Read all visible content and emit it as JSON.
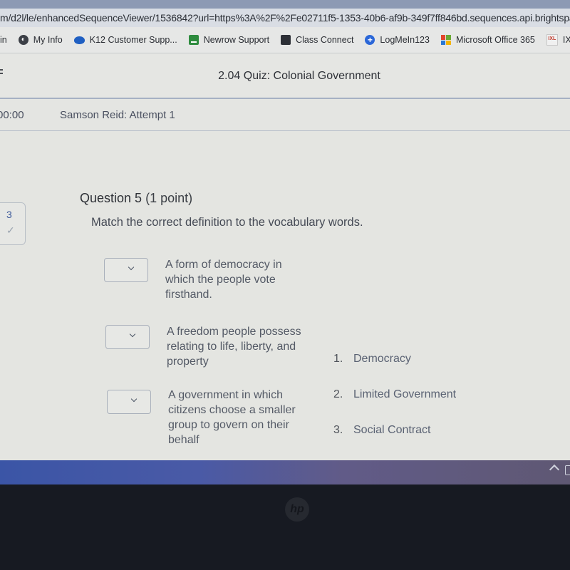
{
  "browser": {
    "url": "m/d2l/le/enhancedSequenceViewer/1536842?url=https%3A%2F%2Fe02711f5-1353-40b6-af9b-349f7ff846bd.sequences.api.brightspace.com",
    "bookmarks": [
      {
        "label": "in",
        "icon": "none"
      },
      {
        "label": "My Info",
        "icon": "globe-icon"
      },
      {
        "label": "K12 Customer Supp...",
        "icon": "cloud-icon"
      },
      {
        "label": "Newrow Support",
        "icon": "newrow-icon"
      },
      {
        "label": "Class Connect",
        "icon": "class-connect-icon"
      },
      {
        "label": "LogMeIn123",
        "icon": "logmein-icon"
      },
      {
        "label": "Microsoft Office 365",
        "icon": "microsoft-icon"
      },
      {
        "label": "IXL - Digital Ac",
        "icon": "ixl-icon"
      }
    ]
  },
  "header": {
    "quiz_title": "2.04 Quiz: Colonial Government",
    "timer": "00:00",
    "attempt": "Samson Reid: Attempt 1"
  },
  "question_nav": {
    "number": "3",
    "status_icon": "✓"
  },
  "question": {
    "title": "Question 5",
    "points": "(1 point)",
    "prompt": "Match the correct definition to the vocabulary words.",
    "definitions": [
      {
        "selected": "",
        "text": "A form of democracy in which the people vote firsthand."
      },
      {
        "selected": "",
        "text": "A freedom people possess relating to life, liberty, and property"
      },
      {
        "selected": "",
        "text": "A government in which citizens choose a smaller group to govern on their behalf"
      }
    ],
    "choices": [
      {
        "number": "1.",
        "label": "Democracy"
      },
      {
        "number": "2.",
        "label": "Limited Government"
      },
      {
        "number": "3.",
        "label": "Social Contract"
      }
    ]
  },
  "device": {
    "logo": "hp"
  }
}
